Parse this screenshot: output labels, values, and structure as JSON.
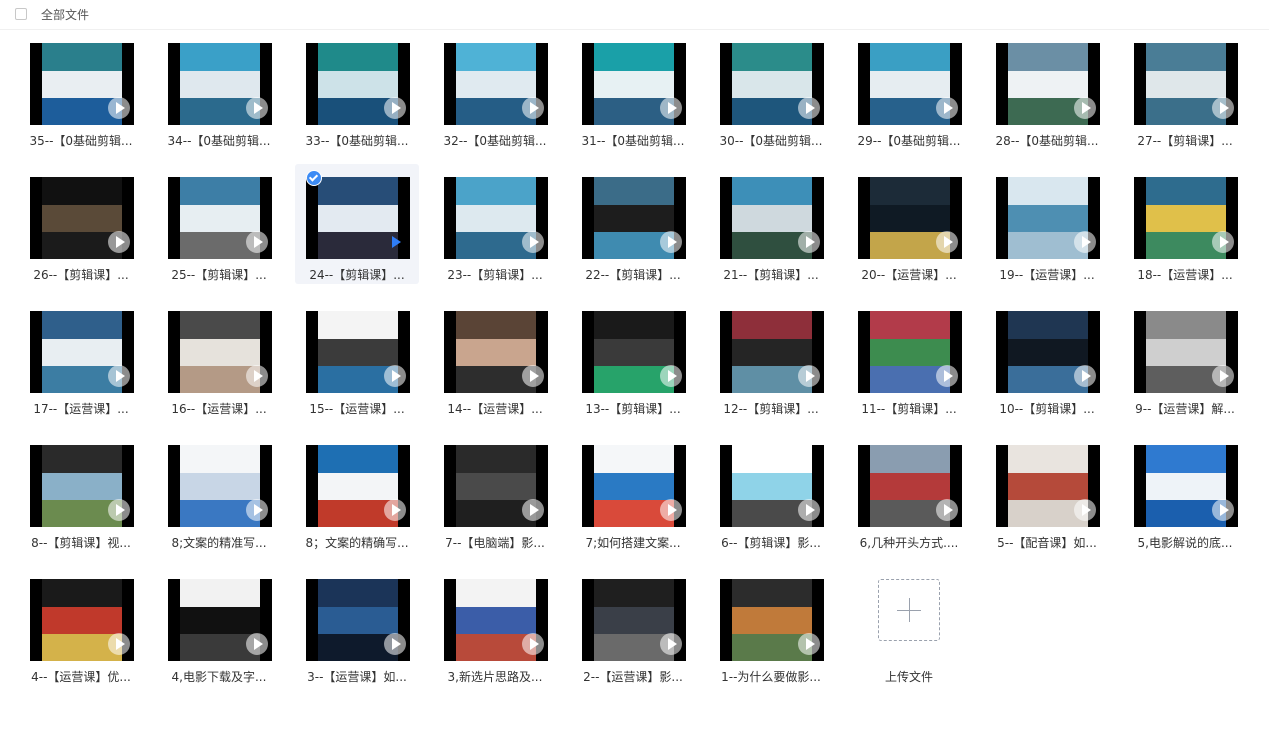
{
  "header": {
    "select_all_label": "全部文件"
  },
  "upload": {
    "label": "上传文件"
  },
  "files": [
    {
      "name": "35--【0基础剪辑...",
      "thumb": [
        "#2a7f8c",
        "#e9eef2",
        "#1d5d9b"
      ],
      "selected": false
    },
    {
      "name": "34--【0基础剪辑...",
      "thumb": [
        "#3aa0c8",
        "#dfe8ee",
        "#2b6a8d"
      ],
      "selected": false
    },
    {
      "name": "33--【0基础剪辑...",
      "thumb": [
        "#1f8a8a",
        "#cde2e8",
        "#19507a"
      ],
      "selected": false
    },
    {
      "name": "32--【0基础剪辑...",
      "thumb": [
        "#4fb2d6",
        "#e0eaf0",
        "#255d86"
      ],
      "selected": false
    },
    {
      "name": "31--【0基础剪辑...",
      "thumb": [
        "#1aa0a8",
        "#e7f1f3",
        "#2c5f84"
      ],
      "selected": false
    },
    {
      "name": "30--【0基础剪辑...",
      "thumb": [
        "#2b8c8a",
        "#d9e6ea",
        "#1e567c"
      ],
      "selected": false
    },
    {
      "name": "29--【0基础剪辑...",
      "thumb": [
        "#3a9fc4",
        "#e6edf1",
        "#27618c"
      ],
      "selected": false
    },
    {
      "name": "28--【0基础剪辑...",
      "thumb": [
        "#6b8fa5",
        "#eef2f4",
        "#3d6a52"
      ],
      "selected": false
    },
    {
      "name": "27--【剪辑课】...",
      "thumb": [
        "#4a7d96",
        "#dfe7ea",
        "#3b6f8a"
      ],
      "selected": false
    },
    {
      "name": "26--【剪辑课】...",
      "thumb": [
        "#111111",
        "#5a4a38",
        "#1b1b1b"
      ],
      "selected": false
    },
    {
      "name": "25--【剪辑课】...",
      "thumb": [
        "#3d7ea6",
        "#e7eef2",
        "#6b6b6b"
      ],
      "selected": false
    },
    {
      "name": "24--【剪辑课】...",
      "thumb": [
        "#274d77",
        "#e3eaf1",
        "#2a2a3a"
      ],
      "selected": true
    },
    {
      "name": "23--【剪辑课】...",
      "thumb": [
        "#4ba3c9",
        "#dde9ef",
        "#2e6a8e"
      ],
      "selected": false
    },
    {
      "name": "22--【剪辑课】...",
      "thumb": [
        "#3b6c88",
        "#1d1d1d",
        "#3f8bb0"
      ],
      "selected": false
    },
    {
      "name": "21--【剪辑课】...",
      "thumb": [
        "#3d8fb8",
        "#cfd9de",
        "#2f4f3f"
      ],
      "selected": false
    },
    {
      "name": "20--【运营课】...",
      "thumb": [
        "#1c2b38",
        "#0f1a24",
        "#c3a54a"
      ],
      "selected": false
    },
    {
      "name": "19--【运营课】...",
      "thumb": [
        "#d9e7ef",
        "#4e8fb2",
        "#9fbed1"
      ],
      "selected": false
    },
    {
      "name": "18--【运营课】...",
      "thumb": [
        "#2e6c8e",
        "#e0c04a",
        "#3d8a5f"
      ],
      "selected": false
    },
    {
      "name": "17--【运营课】...",
      "thumb": [
        "#2f5f8b",
        "#e8eef2",
        "#3c7da3"
      ],
      "selected": false
    },
    {
      "name": "16--【运营课】...",
      "thumb": [
        "#4a4a4a",
        "#e6e2dc",
        "#b49a86"
      ],
      "selected": false
    },
    {
      "name": "15--【运营课】...",
      "thumb": [
        "#f4f4f4",
        "#3b3b3b",
        "#2a6fa2"
      ],
      "selected": false
    },
    {
      "name": "14--【运营课】...",
      "thumb": [
        "#5a4436",
        "#c9a58e",
        "#2d2d2d"
      ],
      "selected": false
    },
    {
      "name": "13--【剪辑课】...",
      "thumb": [
        "#1a1a1a",
        "#3a3a3a",
        "#27a36a"
      ],
      "selected": false
    },
    {
      "name": "12--【剪辑课】...",
      "thumb": [
        "#8e2f3a",
        "#252525",
        "#5f8fa5"
      ],
      "selected": false
    },
    {
      "name": "11--【剪辑课】...",
      "thumb": [
        "#b23b4a",
        "#3d8c4f",
        "#4a6fb0"
      ],
      "selected": false
    },
    {
      "name": "10--【剪辑课】...",
      "thumb": [
        "#1f3652",
        "#101822",
        "#3a6e9a"
      ],
      "selected": false
    },
    {
      "name": "9--【运营课】解...",
      "thumb": [
        "#8a8a8a",
        "#cfcfcf",
        "#5e5e5e"
      ],
      "selected": false
    },
    {
      "name": "8--【剪辑课】视...",
      "thumb": [
        "#2a2a2a",
        "#8ab0c8",
        "#6b8b4f"
      ],
      "selected": false
    },
    {
      "name": "8;文案的精准写...",
      "thumb": [
        "#f4f6f8",
        "#c8d6e6",
        "#3a78c2"
      ],
      "selected": false
    },
    {
      "name": "8；文案的精确写...",
      "thumb": [
        "#1e6fb3",
        "#f3f5f7",
        "#c03a2a"
      ],
      "selected": false
    },
    {
      "name": "7--【电脑端】影...",
      "thumb": [
        "#2a2a2a",
        "#4a4a4a",
        "#1f1f1f"
      ],
      "selected": false
    },
    {
      "name": "7;如何搭建文案...",
      "thumb": [
        "#f5f7f9",
        "#2a7ac4",
        "#d94a3a"
      ],
      "selected": false
    },
    {
      "name": "6--【剪辑课】影...",
      "thumb": [
        "#ffffff",
        "#8fd3e8",
        "#4a4a4a"
      ],
      "selected": false
    },
    {
      "name": "6,几种开头方式....",
      "thumb": [
        "#8a9db0",
        "#b43a3a",
        "#5a5a5a"
      ],
      "selected": false
    },
    {
      "name": "5--【配音课】如...",
      "thumb": [
        "#e9e4df",
        "#b54a3a",
        "#d8d1ca"
      ],
      "selected": false
    },
    {
      "name": "5,电影解说的底...",
      "thumb": [
        "#2f7ad0",
        "#eef3f8",
        "#1b5fae"
      ],
      "selected": false
    },
    {
      "name": "4--【运营课】优...",
      "thumb": [
        "#1a1a1a",
        "#c0392b",
        "#d4b24a"
      ],
      "selected": false
    },
    {
      "name": "4,电影下载及字...",
      "thumb": [
        "#f2f2f2",
        "#111111",
        "#3a3a3a"
      ],
      "selected": false
    },
    {
      "name": "3--【运营课】如...",
      "thumb": [
        "#1b3458",
        "#2a5c93",
        "#0e1a2c"
      ],
      "selected": false
    },
    {
      "name": "3,新选片思路及...",
      "thumb": [
        "#f3f3f3",
        "#3b5da8",
        "#b84a3a"
      ],
      "selected": false
    },
    {
      "name": "2--【运营课】影...",
      "thumb": [
        "#1f1f1f",
        "#3a3f48",
        "#6a6a6a"
      ],
      "selected": false
    },
    {
      "name": "1--为什么要做影...",
      "thumb": [
        "#2c2c2c",
        "#c07a3a",
        "#5a7a4a"
      ],
      "selected": false
    }
  ]
}
